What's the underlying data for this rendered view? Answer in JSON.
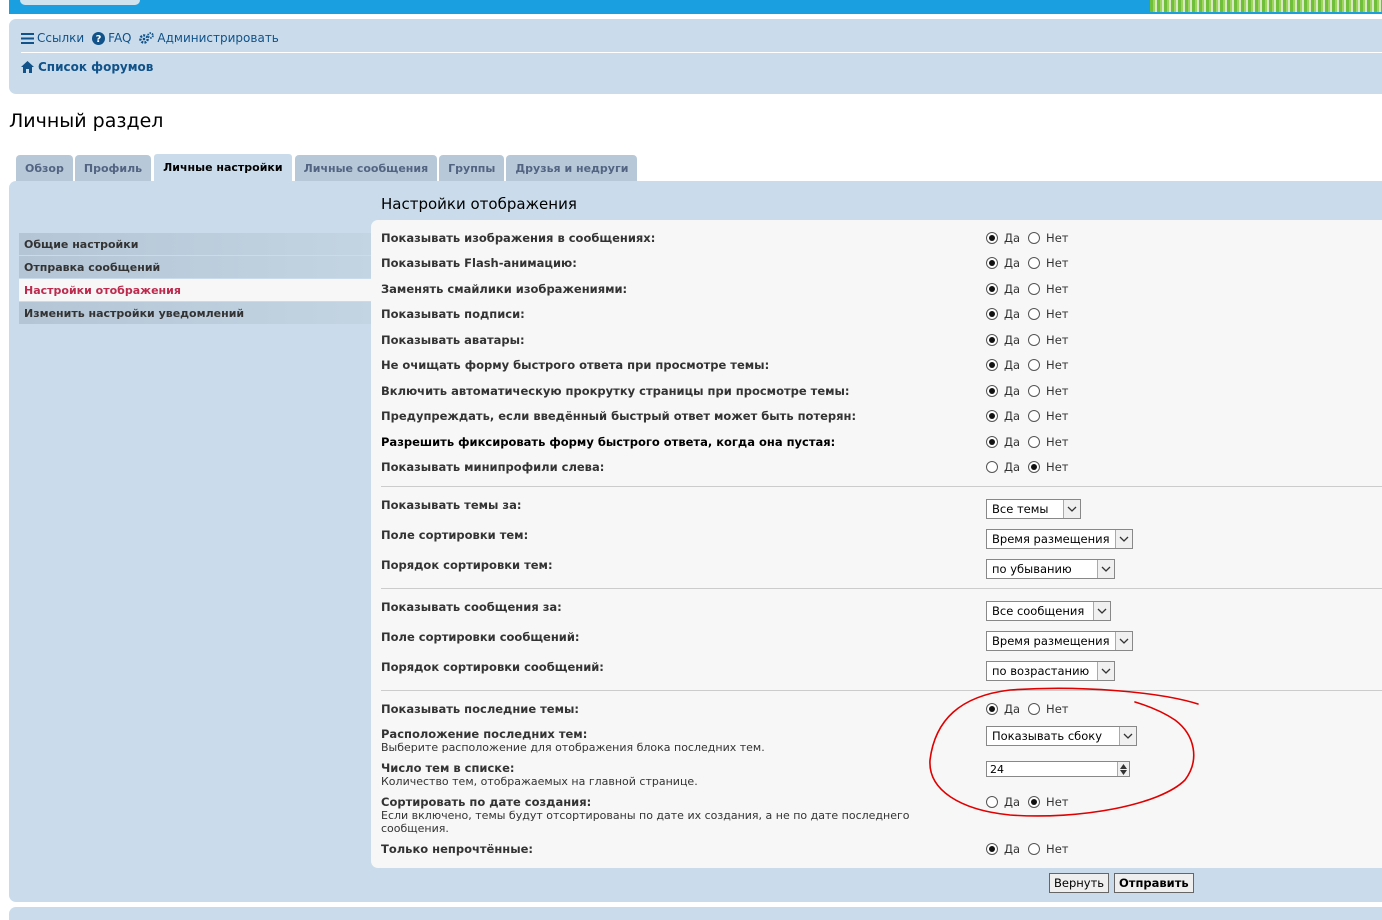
{
  "header": {
    "navlinks": [
      "Ссылки",
      "FAQ",
      "Администрировать"
    ],
    "breadcrumb": "Список форумов"
  },
  "page_title": "Личный раздел",
  "tabs": [
    "Обзор",
    "Профиль",
    "Личные настройки",
    "Личные сообщения",
    "Группы",
    "Друзья и недруги"
  ],
  "active_tab": "Личные настройки",
  "side_menu": [
    "Общие настройки",
    "Отправка сообщений",
    "Настройки отображения",
    "Изменить настройки уведомлений"
  ],
  "active_menu": "Настройки отображения",
  "section_title": "Настройки отображения",
  "radio_labels": {
    "yes": "Да",
    "no": "Нет"
  },
  "display_options": [
    {
      "label": "Показывать изображения в сообщениях:",
      "value": "Да"
    },
    {
      "label": "Показывать Flash-анимацию:",
      "value": "Да"
    },
    {
      "label": "Заменять смайлики изображениями:",
      "value": "Да"
    },
    {
      "label": "Показывать подписи:",
      "value": "Да"
    },
    {
      "label": "Показывать аватары:",
      "value": "Да"
    },
    {
      "label": "Не очищать форму быстрого ответа при просмотре темы:",
      "value": "Да"
    },
    {
      "label": "Включить автоматическую прокрутку страницы при просмотре темы:",
      "value": "Да"
    },
    {
      "label": "Предупреждать, если введённый быстрый ответ может быть потерян:",
      "value": "Да"
    },
    {
      "label": "Разрешить фиксировать форму быстрого ответа, когда она пустая:",
      "value": "Да"
    },
    {
      "label": "Показывать минипрофили слева:",
      "value": "Нет"
    }
  ],
  "topic_options": [
    {
      "label": "Показывать темы за:",
      "value": "Все темы"
    },
    {
      "label": "Поле сортировки тем:",
      "value": "Время размещения"
    },
    {
      "label": "Порядок сортировки тем:",
      "value": "по убыванию"
    }
  ],
  "post_options": [
    {
      "label": "Показывать сообщения за:",
      "value": "Все сообщения"
    },
    {
      "label": "Поле сортировки сообщений:",
      "value": "Время размещения"
    },
    {
      "label": "Порядок сортировки сообщений:",
      "value": "по возрастанию"
    }
  ],
  "recent_topics": {
    "show_label": "Показывать последние темы:",
    "show_value": "Да",
    "position_label": "Расположение последних тем:",
    "position_desc": "Выберите расположение для отображения блока последних тем.",
    "position_value": "Показывать сбоку",
    "count_label": "Число тем в списке:",
    "count_desc": "Количество тем, отображаемых на главной странице.",
    "count_value": "24",
    "sort_label": "Сортировать по дате создания:",
    "sort_desc": "Если включено, темы будут отсортированы по дате их создания, а не по дате последнего сообщения.",
    "sort_value": "Нет",
    "unread_label": "Только непрочтённые:",
    "unread_value": "Да"
  },
  "buttons": {
    "reset": "Вернуть",
    "submit": "Отправить"
  },
  "colors": {
    "panel_bg": "#cadceb",
    "content_bg": "#f7f7f7",
    "link": "#105289",
    "active_menu": "#bc2a4d",
    "annotation": "#e00000"
  }
}
